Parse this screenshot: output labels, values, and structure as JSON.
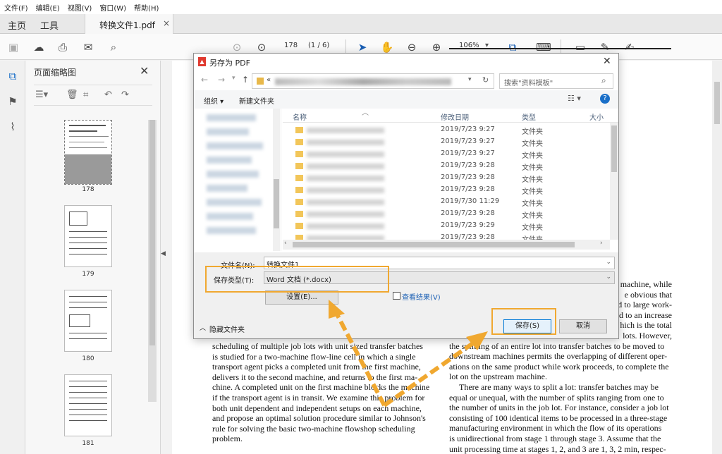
{
  "menu": [
    "文件(F)",
    "编辑(E)",
    "视图(V)",
    "窗口(W)",
    "帮助(H)"
  ],
  "tabs": {
    "home": "主页",
    "tools": "工具",
    "document": "转换文件1.pdf",
    "close": "×"
  },
  "toolbar": {
    "page_current": "178",
    "page_count": "(1 / 6)",
    "zoom": "106%"
  },
  "thumbnail_panel": {
    "title": "页面缩略图",
    "close": "✕",
    "pages": [
      "178",
      "179",
      "180",
      "181"
    ]
  },
  "dialog": {
    "title": "另存为 PDF",
    "address_prefix": "«",
    "search_placeholder": "搜索\"资料模板\"",
    "organize": "组织 ▾",
    "new_folder": "新建文件夹",
    "columns": {
      "name": "名称",
      "date": "修改日期",
      "type": "类型",
      "size": "大小"
    },
    "files": [
      {
        "date": "2019/7/23 9:27",
        "type": "文件夹"
      },
      {
        "date": "2019/7/23 9:27",
        "type": "文件夹"
      },
      {
        "date": "2019/7/23 9:27",
        "type": "文件夹"
      },
      {
        "date": "2019/7/23 9:28",
        "type": "文件夹"
      },
      {
        "date": "2019/7/23 9:28",
        "type": "文件夹"
      },
      {
        "date": "2019/7/23 9:28",
        "type": "文件夹"
      },
      {
        "date": "2019/7/30 11:29",
        "type": "文件夹"
      },
      {
        "date": "2019/7/23 9:28",
        "type": "文件夹"
      },
      {
        "date": "2019/7/23 9:29",
        "type": "文件夹"
      },
      {
        "date": "2019/7/23 9:28",
        "type": "文件夹"
      }
    ],
    "filename_label": "文件名(N):",
    "filename_value": "转换文件1",
    "filetype_label": "保存类型(T):",
    "filetype_value": "Word 文档 (*.docx)",
    "settings_button": "设置(E)...",
    "view_results_label": "查看结果(V)",
    "hide_folders": "隐藏文件夹",
    "save_button": "保存(S)",
    "cancel_button": "取消"
  },
  "document": {
    "right_column_tail": [
      "machine, while",
      "e obvious that",
      "d to large work-",
      "d to an increase",
      "hich is the total",
      "lots. However,"
    ],
    "right_column": [
      "the splitting of an entire lot into transfer batches to be moved to",
      "downstream machines permits the overlapping of different oper-",
      "ations on the same product while work proceeds, to complete the",
      "lot on the upstream machine.",
      "There are many ways to split a lot: transfer batches may be",
      "equal or unequal, with the number of splits ranging from one to",
      "the number of units in the job lot. For instance, consider a job lot",
      "consisting of 100 identical items to be processed in a three-stage",
      "manufacturing environment in which the flow of its operations",
      "is unidirectional from stage 1 through stage 3. Assume that the",
      "unit processing time at stages 1, 2, and 3 are 1, 3, 2 min, respec-"
    ],
    "left_column": [
      "scheduling of multiple job lots with unit sized transfer batches",
      "is studied for a two-machine flow-line cell in which a single",
      "transport agent picks a completed unit from the first machine,",
      "delivers it to the second machine, and returns to the first ma-",
      "chine. A completed unit on the first machine blocks the machine",
      "if the transport agent is in transit. We examine this problem for",
      "both unit dependent and independent setups on each machine,",
      "and propose an optimal solution procedure similar to Johnson's",
      "rule for solving the basic two-machine flowshop scheduling",
      "problem."
    ]
  },
  "annotation_color": "#f0a830"
}
